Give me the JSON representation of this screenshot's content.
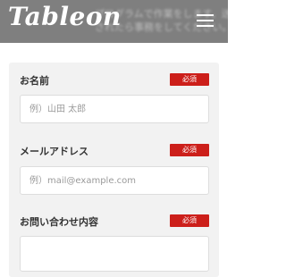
{
  "header": {
    "logo": "Tableon",
    "background_text": [
      "プログラムで作業をします。送信完了",
      "されたら事務をしてください。"
    ],
    "menu_icon": "hamburger-menu-icon"
  },
  "form": {
    "fields": [
      {
        "label": "お名前",
        "badge": "必須",
        "placeholder": "例）山田 太郎",
        "value": ""
      },
      {
        "label": "メールアドレス",
        "badge": "必須",
        "placeholder": "例）mail@example.com",
        "value": ""
      },
      {
        "label": "お問い合わせ内容",
        "badge": "必須",
        "placeholder": "",
        "value": ""
      }
    ]
  },
  "colors": {
    "header_bg": "#7f7f7f",
    "panel_bg": "#f2f2f2",
    "badge_bg": "#cc1f1a"
  }
}
